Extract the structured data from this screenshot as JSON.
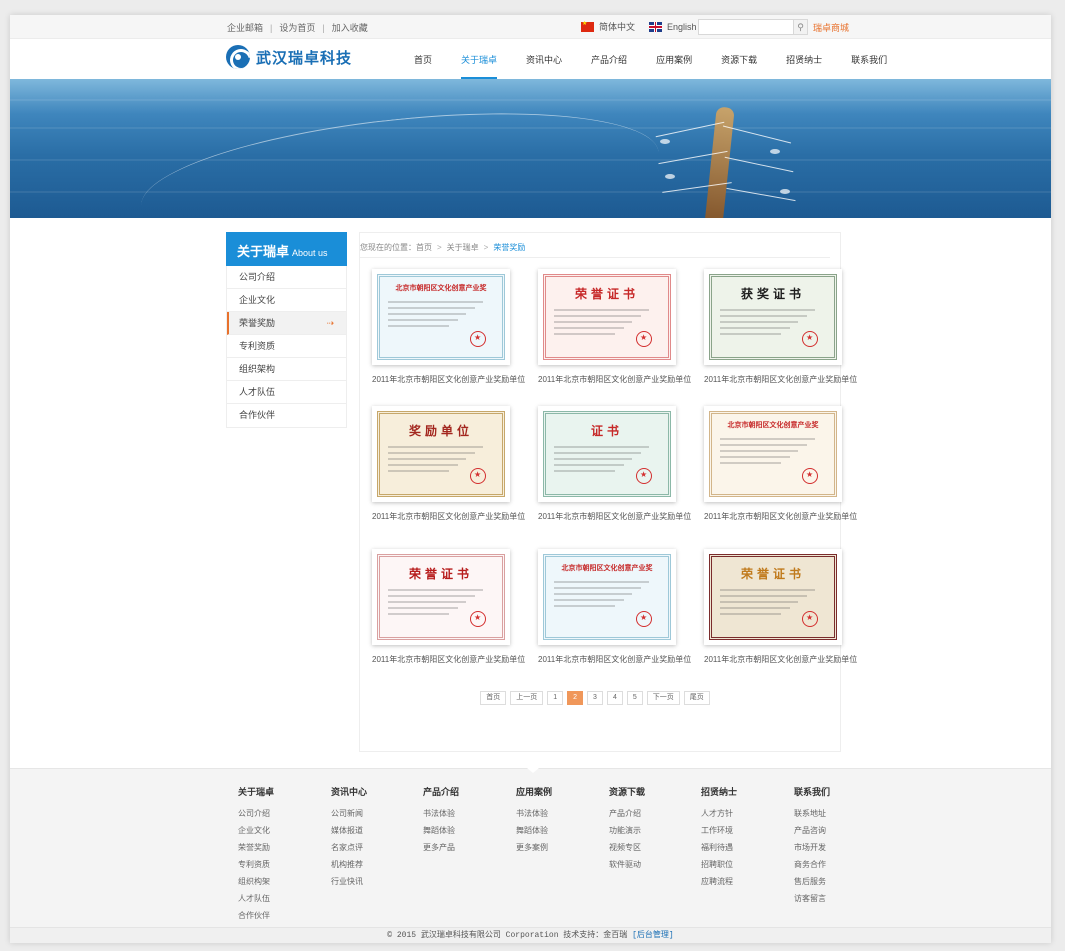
{
  "topbar": {
    "links": [
      "企业邮箱",
      "设为首页",
      "加入收藏"
    ],
    "lang_cn": "简体中文",
    "lang_en": "English",
    "search_placeholder": "",
    "mall": "瑞卓商城"
  },
  "header": {
    "logo_text": "武汉瑞卓科技",
    "nav": [
      "首页",
      "关于瑞卓",
      "资讯中心",
      "产品介绍",
      "应用案例",
      "资源下载",
      "招贤纳士",
      "联系我们"
    ],
    "active_nav": "关于瑞卓"
  },
  "sidebar": {
    "title_cn": "关于瑞卓",
    "title_en": "About us",
    "items": [
      "公司介绍",
      "企业文化",
      "荣誉奖励",
      "专利资质",
      "组织架构",
      "人才队伍",
      "合作伙伴"
    ],
    "active": "荣誉奖励"
  },
  "breadcrumb": {
    "prefix": "您现在的位置：",
    "home": "首页",
    "parent": "关于瑞卓",
    "current": "荣誉奖励"
  },
  "certificates": [
    {
      "title": "北京市朝阳区文化创意产业奖",
      "caption": "2011年北京市朝阳区文化创意产业奖励单位",
      "style": "blue"
    },
    {
      "title": "荣誉证书",
      "caption": "2011年北京市朝阳区文化创意产业奖励单位",
      "style": "red"
    },
    {
      "title": "获奖证书",
      "caption": "2011年北京市朝阳区文化创意产业奖励单位",
      "style": "green"
    },
    {
      "title": "奖励单位",
      "caption": "2011年北京市朝阳区文化创意产业奖励单位",
      "style": "gold"
    },
    {
      "title": "证书",
      "caption": "2011年北京市朝阳区文化创意产业奖励单位",
      "style": "mint"
    },
    {
      "title": "北京市朝阳区文化创意产业奖",
      "caption": "2011年北京市朝阳区文化创意产业奖励单位",
      "style": "tan"
    },
    {
      "title": "荣誉证书",
      "caption": "2011年北京市朝阳区文化创意产业奖励单位",
      "style": "pink"
    },
    {
      "title": "北京市朝阳区文化创意产业奖",
      "caption": "2011年北京市朝阳区文化创意产业奖励单位",
      "style": "blue"
    },
    {
      "title": "荣誉证书",
      "caption": "2011年北京市朝阳区文化创意产业奖励单位",
      "style": "photo"
    }
  ],
  "pager": {
    "first": "首页",
    "prev": "上一页",
    "pages": [
      "1",
      "2",
      "3",
      "4",
      "5"
    ],
    "current": "2",
    "next": "下一页",
    "last": "尾页"
  },
  "footer": {
    "columns": [
      {
        "title": "关于瑞卓",
        "items": [
          "公司介绍",
          "企业文化",
          "荣誉奖励",
          "专利资质",
          "组织构架",
          "人才队伍",
          "合作伙伴"
        ]
      },
      {
        "title": "资讯中心",
        "items": [
          "公司新闻",
          "媒体报道",
          "名家点评",
          "机构推荐",
          "行业快讯"
        ]
      },
      {
        "title": "产品介绍",
        "items": [
          "书法体验",
          "舞蹈体验",
          "更多产品"
        ]
      },
      {
        "title": "应用案例",
        "items": [
          "书法体验",
          "舞蹈体验",
          "更多案例"
        ]
      },
      {
        "title": "资源下载",
        "items": [
          "产品介绍",
          "功能演示",
          "视频专区",
          "软件驱动"
        ]
      },
      {
        "title": "招贤纳士",
        "items": [
          "人才方针",
          "工作环境",
          "福利待遇",
          "招聘职位",
          "应聘流程"
        ]
      },
      {
        "title": "联系我们",
        "items": [
          "联系地址",
          "产品咨询",
          "市场开发",
          "商务合作",
          "售后服务",
          "访客留言"
        ]
      }
    ],
    "copyright": "© 2015 武汉瑞卓科技有限公司 Corporation 技术支持：金百瑞",
    "admin": "[后台管理]"
  },
  "colors": {
    "brand": "#1a8ed8",
    "accent": "#e8712c",
    "pager_current": "#f0975a"
  }
}
